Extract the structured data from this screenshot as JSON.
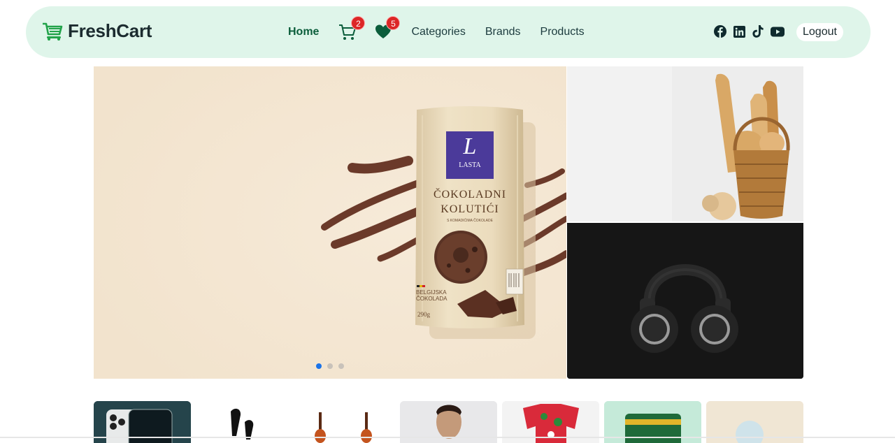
{
  "brand": {
    "name": "FreshCart"
  },
  "nav": {
    "home": "Home",
    "cart_count": "2",
    "wishlist_count": "5",
    "categories": "Categories",
    "brands": "Brands",
    "products": "Products"
  },
  "socials": [
    "facebook-icon",
    "linkedin-icon",
    "tiktok-icon",
    "youtube-icon"
  ],
  "auth": {
    "logout": "Logout"
  },
  "hero": {
    "package": {
      "brand": "LASTA",
      "title_line1": "ČOKOLADNI",
      "title_line2": "KOLUTIĆI",
      "subtitle": "S KOMADIĆIMA ČOKOLADE",
      "origin_line1": "BELGIJSKA",
      "origin_line2": "ČOKOLADA",
      "weight": "290g"
    },
    "slide_count": 3,
    "active_slide": 1
  },
  "colors": {
    "nav_bg": "#dff5ea",
    "brand_green": "#0b5d3b",
    "badge_red": "#dc2626",
    "dot_active": "#1a73e8"
  }
}
